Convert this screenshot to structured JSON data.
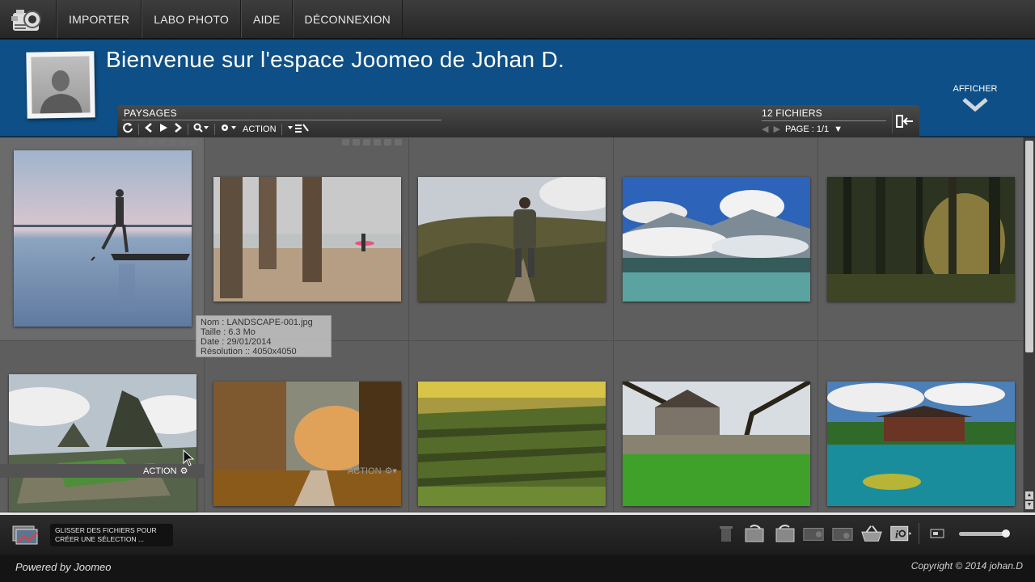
{
  "nav": {
    "items": [
      {
        "label": "IMPORTER"
      },
      {
        "label": "LABO PHOTO"
      },
      {
        "label": "AIDE"
      },
      {
        "label": "DÉCONNEXION"
      }
    ]
  },
  "header": {
    "welcome": "Bienvenue sur l'espace Joomeo de Johan D.",
    "afficher_label": "AFFICHER"
  },
  "toolbar": {
    "album_title": "PAYSAGES",
    "action_label": "ACTION",
    "file_count": "12 FICHIERS",
    "page_label": "PAGE : 1/1"
  },
  "grid": {
    "action_label": "ACTION",
    "thumbnails": [
      {
        "subject": "fisherman on boat"
      },
      {
        "subject": "beach pier surfer"
      },
      {
        "subject": "hiker on trail"
      },
      {
        "subject": "mountain lake clouds"
      },
      {
        "subject": "sunlit forest"
      },
      {
        "subject": "mountain ruins"
      },
      {
        "subject": "autumn path"
      },
      {
        "subject": "vineyard"
      },
      {
        "subject": "village church"
      },
      {
        "subject": "pagoda lake"
      }
    ]
  },
  "tooltip": {
    "name": "Nom : LANDSCAPE-001.jpg",
    "size": "Taille : 6.3 Mo",
    "date": "Date : 29/01/2014",
    "resolution": "Résolution :: 4050x4050"
  },
  "bottom": {
    "drag_line1": "GLISSER DES FICHIERS POUR",
    "drag_line2": "CRÉER UNE SÉLECTION ..."
  },
  "footer": {
    "powered": "Powered by Joomeo",
    "copyright": "Copyright © 2014 johan.D"
  },
  "colors": {
    "banner": "#0d4f86",
    "grid": "#5e5e5e"
  }
}
